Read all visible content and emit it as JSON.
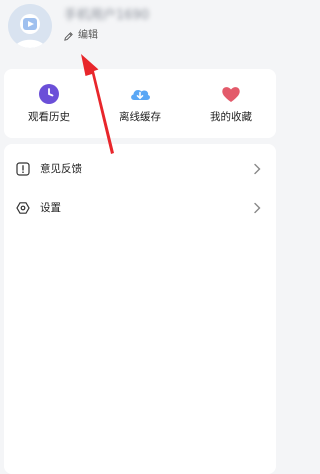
{
  "profile": {
    "username": "手机用户1690",
    "edit_label": "编辑"
  },
  "quick_actions": [
    {
      "label": "观看历史",
      "icon": "clock-icon",
      "color": "#6b4fd8"
    },
    {
      "label": "离线缓存",
      "icon": "cloud-download-icon",
      "color": "#5aa7f5"
    },
    {
      "label": "我的收藏",
      "icon": "heart-icon",
      "color": "#e35a6a"
    }
  ],
  "menu": [
    {
      "label": "意见反馈",
      "icon": "feedback-icon"
    },
    {
      "label": "设置",
      "icon": "settings-icon"
    }
  ],
  "colors": {
    "background": "#f4f5f7",
    "card": "#ffffff",
    "arrow": "#e8262b"
  }
}
